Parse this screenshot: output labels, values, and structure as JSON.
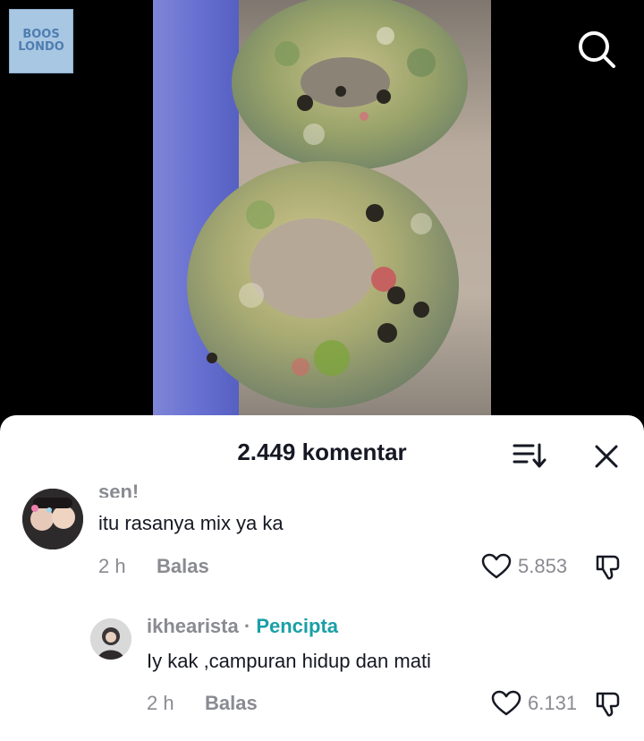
{
  "channel_logo": {
    "text": "BOOS LONDO"
  },
  "icons": {
    "search": "search-icon",
    "sort": "sort-icon",
    "close": "close-icon",
    "like": "heart-outline-icon",
    "dislike": "thumbs-down-icon"
  },
  "comments_sheet": {
    "title": "2.449 komentar"
  },
  "comments": [
    {
      "username": "sen!",
      "text": "itu rasanya mix ya ka",
      "time": "2 h",
      "reply_label": "Balas",
      "likes": "5.853"
    },
    {
      "username": "ikhearista",
      "separator": "·",
      "badge": "Pencipta",
      "text": "Iy kak ,campuran hidup dan mati",
      "time": "2 h",
      "reply_label": "Balas",
      "likes": "6.131"
    }
  ],
  "colors": {
    "creator_badge": "#1a9fa6",
    "secondary_text": "#8a8b91",
    "primary_text": "#161823"
  }
}
